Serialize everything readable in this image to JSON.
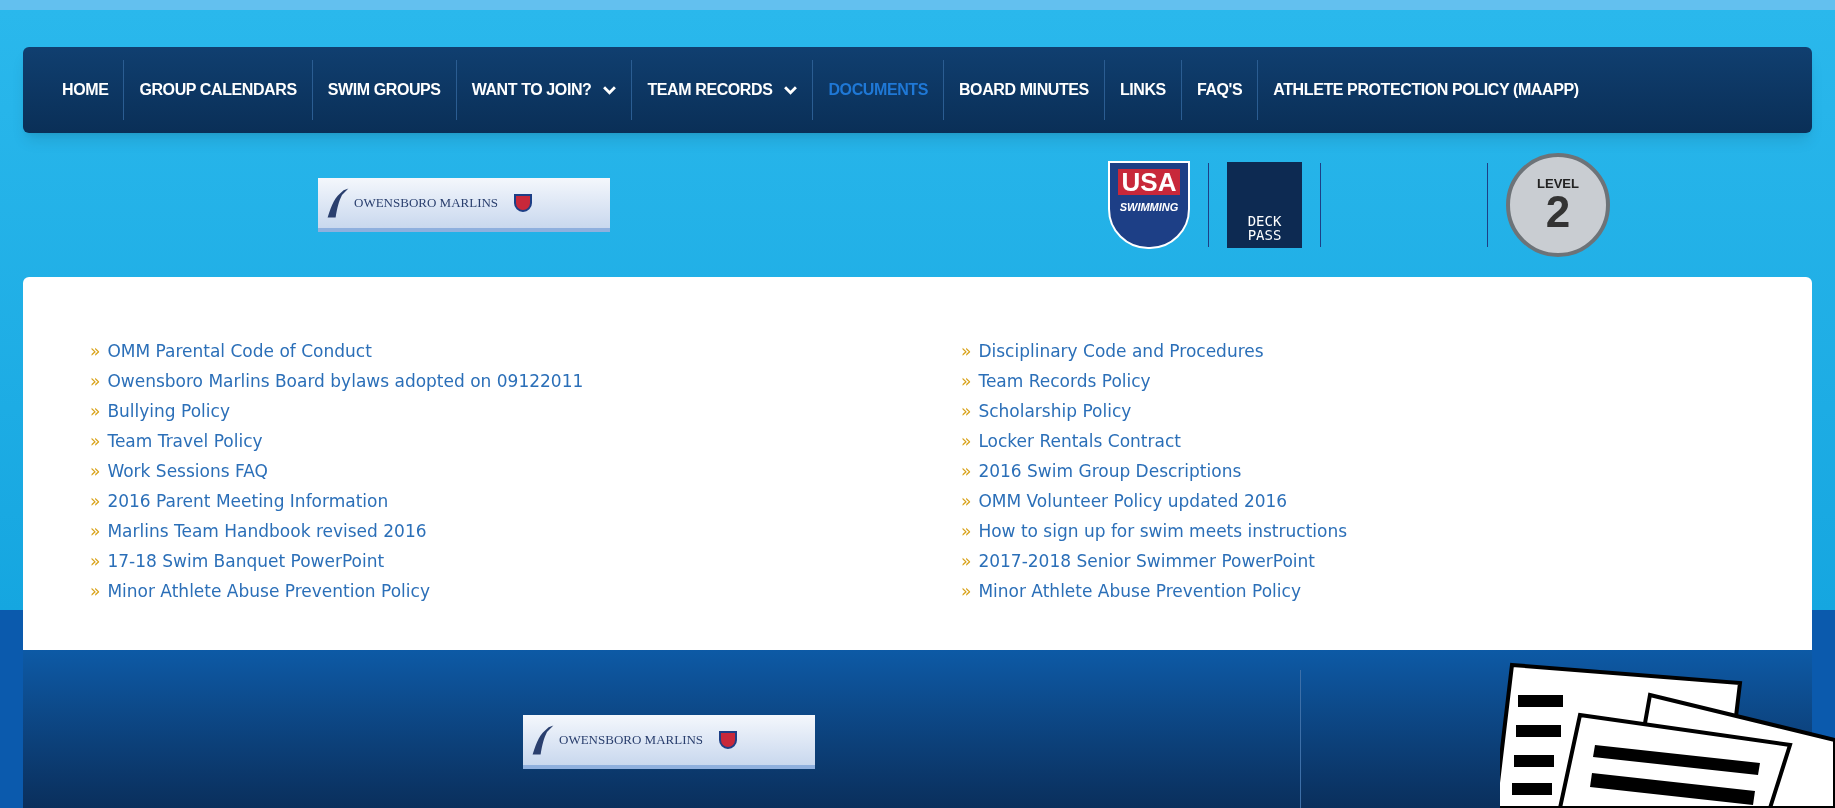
{
  "nav": [
    {
      "label": "HOME",
      "dropdown": false,
      "selected": false
    },
    {
      "label": "GROUP CALENDARS",
      "dropdown": false,
      "selected": false
    },
    {
      "label": "SWIM GROUPS",
      "dropdown": false,
      "selected": false
    },
    {
      "label": "WANT TO JOIN?",
      "dropdown": true,
      "selected": false
    },
    {
      "label": "TEAM RECORDS",
      "dropdown": true,
      "selected": false
    },
    {
      "label": "DOCUMENTS",
      "dropdown": false,
      "selected": true
    },
    {
      "label": "BOARD MINUTES",
      "dropdown": false,
      "selected": false
    },
    {
      "label": "LINKS",
      "dropdown": false,
      "selected": false
    },
    {
      "label": "FAQ'S",
      "dropdown": false,
      "selected": false
    },
    {
      "label": "ATHLETE PROTECTION POLICY (MAAPP)",
      "dropdown": false,
      "selected": false
    }
  ],
  "header": {
    "club_logo": {
      "text": "OWENSBORO MARLINS"
    },
    "partner_logos": [
      {
        "kind": "shield",
        "line_1": "USA",
        "line_2": "SWIMMING"
      },
      {
        "kind": "deck",
        "line_1": "DECK",
        "line_2": "PASS"
      },
      {
        "kind": "blank"
      },
      {
        "kind": "badge",
        "line_1": "LEVEL",
        "line_2": "2"
      }
    ]
  },
  "documents": {
    "columns": [
      [
        {
          "marker": "»",
          "label": "OMM Parental Code of Conduct"
        },
        {
          "marker": "»",
          "label": "Owensboro Marlins Board bylaws adopted on 09122011"
        },
        {
          "marker": "»",
          "label": "Bullying Policy"
        },
        {
          "marker": "»",
          "label": "Team Travel Policy"
        },
        {
          "marker": "»",
          "label": "Work Sessions FAQ"
        },
        {
          "marker": "»",
          "label": "2016 Parent Meeting Information"
        },
        {
          "marker": "»",
          "label": "Marlins Team Handbook revised 2016"
        },
        {
          "marker": "»",
          "label": "17-18 Swim Banquet PowerPoint"
        },
        {
          "marker": "»",
          "label": "Minor Athlete Abuse Prevention Policy"
        }
      ],
      [
        {
          "marker": "»",
          "label": "Disciplinary Code and Procedures"
        },
        {
          "marker": "»",
          "label": "Team Records Policy"
        },
        {
          "marker": "»",
          "label": "Scholarship Policy"
        },
        {
          "marker": "»",
          "label": "Locker Rentals Contract"
        },
        {
          "marker": "»",
          "label": "2016 Swim Group Descriptions"
        },
        {
          "marker": "»",
          "label": "OMM Volunteer Policy updated 2016"
        },
        {
          "marker": "»",
          "label": "How to sign up for swim meets instructions"
        },
        {
          "marker": "»",
          "label": "2017-2018 Senior Swimmer PowerPoint"
        },
        {
          "marker": "»",
          "label": "Minor Athlete Abuse Prevention Policy"
        }
      ]
    ]
  },
  "footer": {
    "club_logo": {
      "text": "OWENSBORO MARLINS"
    }
  }
}
